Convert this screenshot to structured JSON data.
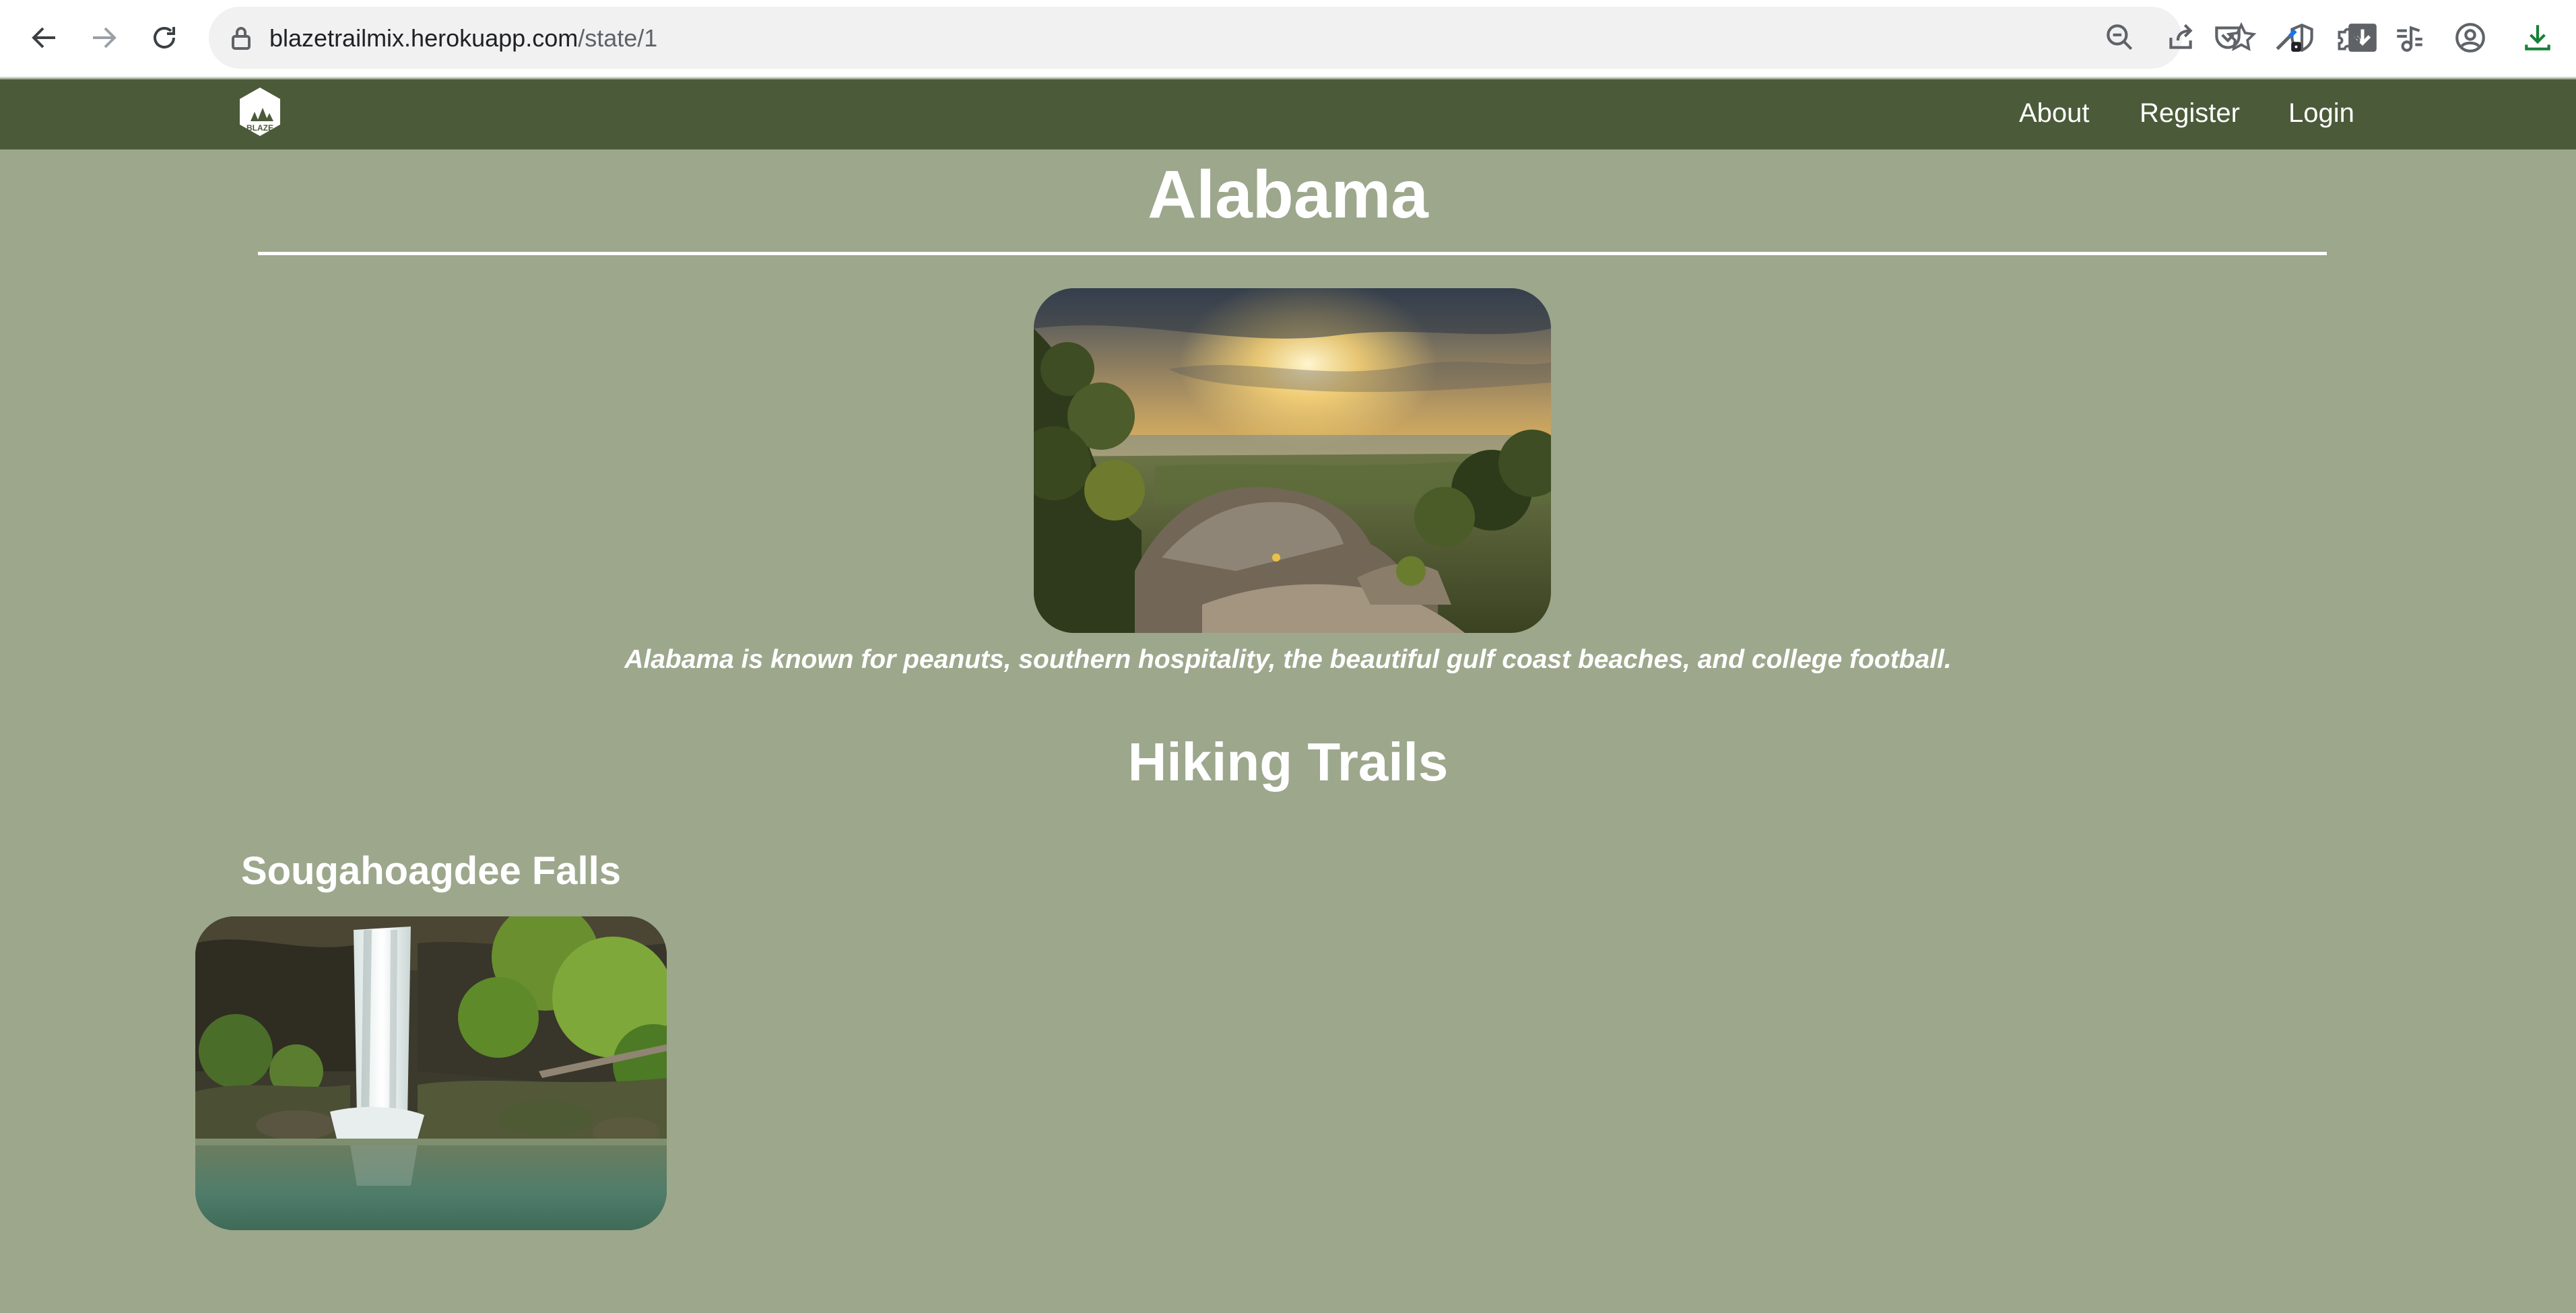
{
  "browser": {
    "url_host": "blazetrailmix.herokuapp.com",
    "url_path": "/state/1",
    "icons": [
      "back-arrow-icon",
      "forward-arrow-icon",
      "reload-icon",
      "lock-icon",
      "zoom-out-icon",
      "share-icon",
      "star-icon",
      "shield-icon",
      "download-box-icon",
      "pocket-icon",
      "eyedropper-icon",
      "puzzle-icon",
      "music-list-icon",
      "profile-icon",
      "download-icon"
    ]
  },
  "navbar": {
    "logo_text": "BLAZE",
    "links": [
      "About",
      "Register",
      "Login"
    ]
  },
  "state": {
    "title": "Alabama",
    "description": "Alabama is known for peanuts, southern hospitality, the beautiful gulf coast beaches, and college football."
  },
  "trails": {
    "section_title": "Hiking Trails",
    "items": [
      {
        "name": "Sougahoagdee Falls"
      }
    ]
  },
  "colors": {
    "page_background": "#9ca78c",
    "navbar_background": "#4b5a39",
    "text": "#ffffff"
  }
}
